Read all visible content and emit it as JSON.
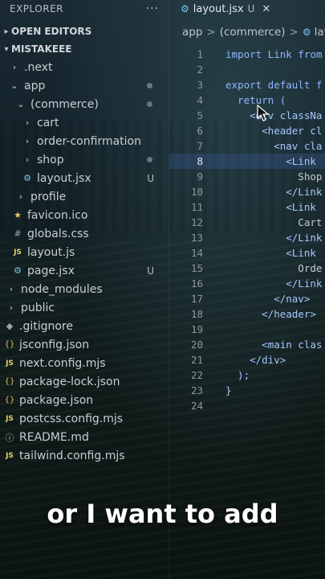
{
  "explorer": {
    "title": "EXPLORER",
    "more": "···",
    "open_editors": "OPEN EDITORS",
    "project": "MISTAKEEE",
    "items": [
      {
        "label": ".next",
        "icon": "folder-chevron-right",
        "status": ""
      },
      {
        "label": "app",
        "icon": "folder-chevron-down",
        "status": "dot"
      },
      {
        "label": "(commerce)",
        "icon": "folder-chevron-down",
        "status": "dot"
      },
      {
        "label": "cart",
        "icon": "folder-chevron-right",
        "status": ""
      },
      {
        "label": "order-confirmation",
        "icon": "folder-chevron-right",
        "status": ""
      },
      {
        "label": "shop",
        "icon": "folder-chevron-right",
        "status": "dot"
      },
      {
        "label": "layout.jsx",
        "icon": "react-icon",
        "status": "U"
      },
      {
        "label": "profile",
        "icon": "folder-chevron-right",
        "status": ""
      },
      {
        "label": "favicon.ico",
        "icon": "star-icon",
        "status": ""
      },
      {
        "label": "globals.css",
        "icon": "hash-icon",
        "status": ""
      },
      {
        "label": "layout.js",
        "icon": "js-icon",
        "status": ""
      },
      {
        "label": "page.jsx",
        "icon": "react-icon",
        "status": "U"
      },
      {
        "label": "node_modules",
        "icon": "folder-chevron-right",
        "status": ""
      },
      {
        "label": "public",
        "icon": "folder-chevron-right",
        "status": ""
      },
      {
        "label": ".gitignore",
        "icon": "git-icon",
        "status": ""
      },
      {
        "label": "jsconfig.json",
        "icon": "json-icon",
        "status": ""
      },
      {
        "label": "next.config.mjs",
        "icon": "js-icon",
        "status": ""
      },
      {
        "label": "package-lock.json",
        "icon": "json-icon",
        "status": ""
      },
      {
        "label": "package.json",
        "icon": "json-icon",
        "status": ""
      },
      {
        "label": "postcss.config.mjs",
        "icon": "js-icon",
        "status": ""
      },
      {
        "label": "README.md",
        "icon": "info-icon",
        "status": ""
      },
      {
        "label": "tailwind.config.mjs",
        "icon": "js-icon",
        "status": ""
      }
    ]
  },
  "tab": {
    "label": "layout.jsx",
    "status": "U",
    "close": "✕"
  },
  "breadcrumb": {
    "part1": "app",
    "sep": ">",
    "part2": "(commerce)",
    "part3": "layo"
  },
  "code_lines": [
    {
      "n": "1",
      "text": "import Link from"
    },
    {
      "n": "2",
      "text": ""
    },
    {
      "n": "3",
      "text": "export default f"
    },
    {
      "n": "4",
      "text": "  return ("
    },
    {
      "n": "5",
      "text": "    <div classNa"
    },
    {
      "n": "6",
      "text": "      <header cl"
    },
    {
      "n": "7",
      "text": "        <nav cla"
    },
    {
      "n": "8",
      "text": "          <Link"
    },
    {
      "n": "9",
      "text": "            Shop"
    },
    {
      "n": "10",
      "text": "          </Link"
    },
    {
      "n": "11",
      "text": "          <Link"
    },
    {
      "n": "12",
      "text": "            Cart"
    },
    {
      "n": "13",
      "text": "          </Link"
    },
    {
      "n": "14",
      "text": "          <Link"
    },
    {
      "n": "15",
      "text": "            Orde"
    },
    {
      "n": "16",
      "text": "          </Link"
    },
    {
      "n": "17",
      "text": "        </nav>"
    },
    {
      "n": "18",
      "text": "      </header>"
    },
    {
      "n": "19",
      "text": ""
    },
    {
      "n": "20",
      "text": "      <main clas"
    },
    {
      "n": "21",
      "text": "    </div>"
    },
    {
      "n": "22",
      "text": "  );"
    },
    {
      "n": "23",
      "text": "}"
    },
    {
      "n": "24",
      "text": ""
    }
  ],
  "highlighted_line": "8",
  "caption": "or I want to add",
  "colors": {
    "accent": "#8fb7ff",
    "highlight": "#3c5a96"
  }
}
